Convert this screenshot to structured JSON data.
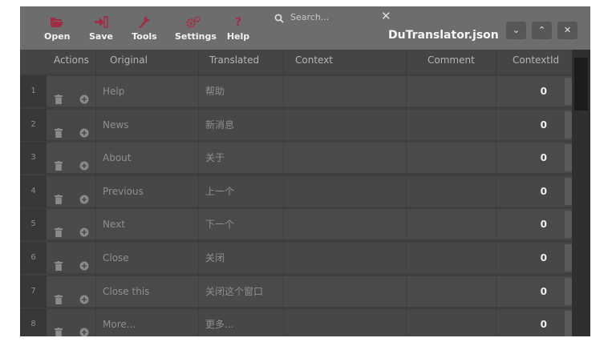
{
  "window": {
    "title": "DuTranslator.json",
    "minimize_label": "⌄",
    "maximize_label": "⌃",
    "close_label": "✕"
  },
  "toolbar": {
    "accent_color": "#a22b45",
    "items": [
      {
        "label": "Open",
        "icon": "folder-open-icon"
      },
      {
        "label": "Save",
        "icon": "save-icon"
      },
      {
        "label": "Tools",
        "icon": "wrench-icon"
      },
      {
        "label": "Settings",
        "icon": "gear-icon"
      },
      {
        "label": "Help",
        "icon": "question-icon"
      }
    ]
  },
  "search": {
    "placeholder": "Search...",
    "value": "",
    "clear_label": "✕"
  },
  "table": {
    "columns": [
      "Actions",
      "Original",
      "Translated",
      "Context",
      "Comment",
      "ContextId"
    ],
    "rows": [
      {
        "num": "1",
        "original": "Help",
        "translated": "帮助",
        "context": "",
        "comment": "",
        "context_id": "0"
      },
      {
        "num": "2",
        "original": "News",
        "translated": "新消息",
        "context": "",
        "comment": "",
        "context_id": "0"
      },
      {
        "num": "3",
        "original": "About",
        "translated": "关于",
        "context": "",
        "comment": "",
        "context_id": "0"
      },
      {
        "num": "4",
        "original": "Previous",
        "translated": "上一个",
        "context": "",
        "comment": "",
        "context_id": "0"
      },
      {
        "num": "5",
        "original": "Next",
        "translated": "下一个",
        "context": "",
        "comment": "",
        "context_id": "0"
      },
      {
        "num": "6",
        "original": "Close",
        "translated": "关闭",
        "context": "",
        "comment": "",
        "context_id": "0"
      },
      {
        "num": "7",
        "original": "Close this",
        "translated": "关闭这个窗口",
        "context": "",
        "comment": "",
        "context_id": "0"
      },
      {
        "num": "8",
        "original": "More...",
        "translated": "更多...",
        "context": "",
        "comment": "",
        "context_id": "0"
      }
    ]
  }
}
